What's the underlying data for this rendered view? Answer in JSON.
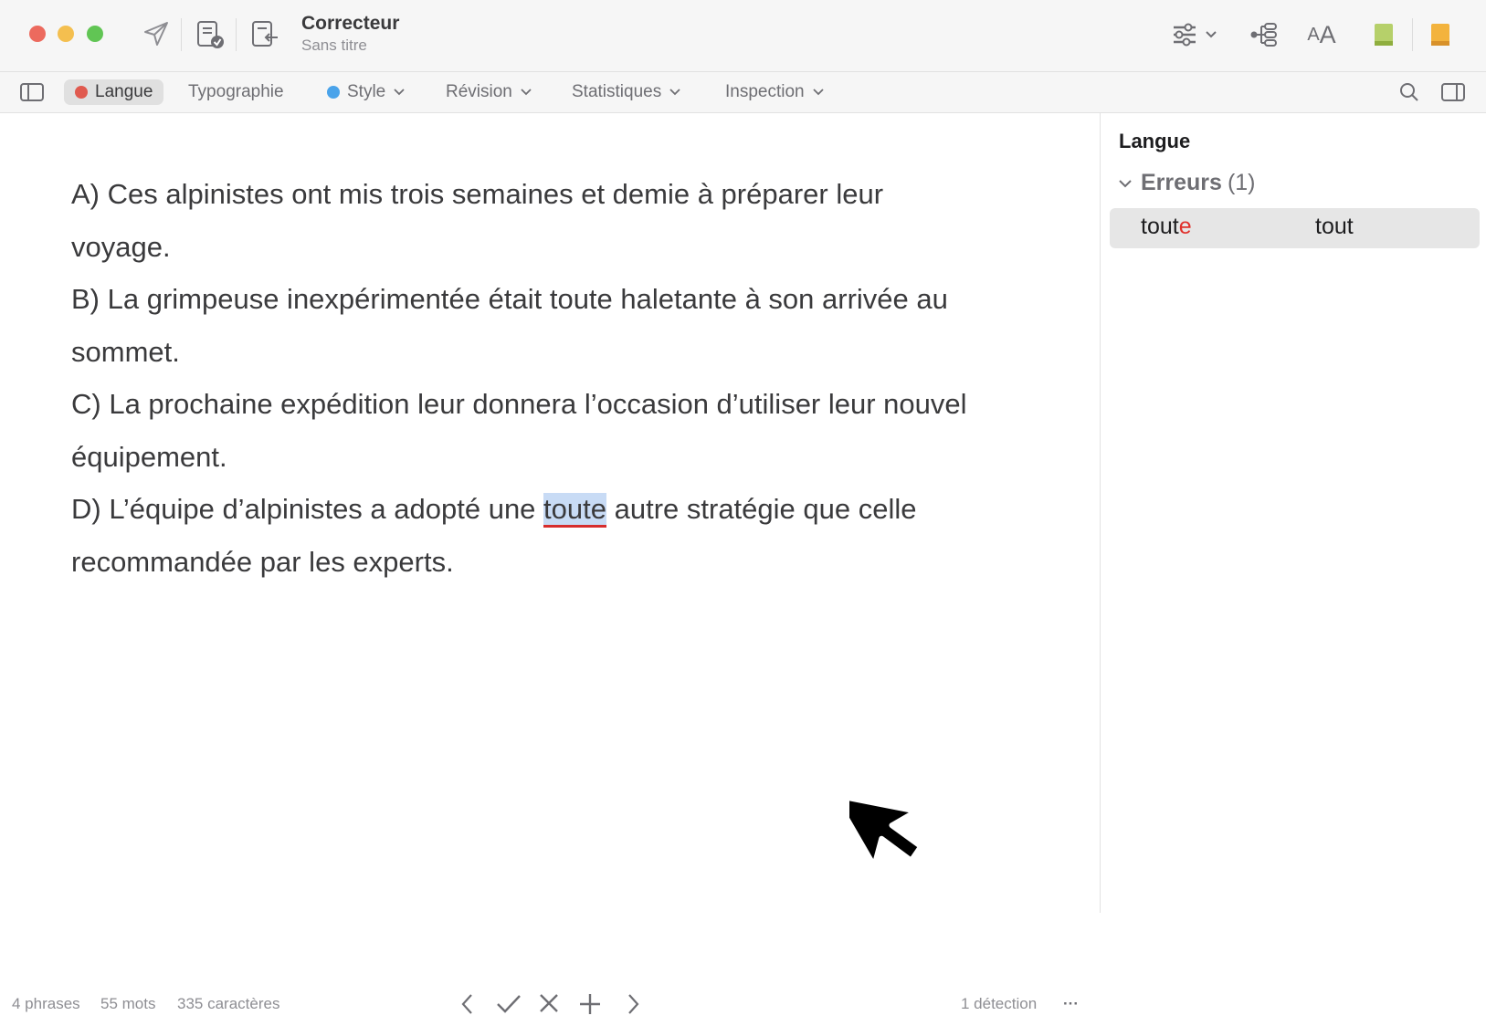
{
  "app": {
    "title": "Correcteur",
    "subtitle": "Sans titre"
  },
  "tabs": [
    {
      "label": "Langue",
      "dot_color": "#e05a4f",
      "active": true
    },
    {
      "label": "Typographie"
    },
    {
      "label": "Style",
      "dot_color": "#4aa3ea"
    },
    {
      "label": "Révision"
    },
    {
      "label": "Statistiques"
    },
    {
      "label": "Inspection"
    }
  ],
  "document": {
    "lines": [
      "A) Ces alpinistes ont mis trois semaines et demie à préparer leur",
      "voyage.",
      "B) La grimpeuse inexpérimentée était toute haletante à son arrivée au",
      "sommet.",
      "C) La prochaine expédition leur donnera l’occasion d’utiliser leur nouvel",
      "équipement.",
      "recommandée par les experts."
    ],
    "line_d_before": "D) L’équipe d’alpinistes a adopté une ",
    "line_d_error": "toute",
    "line_d_after": " autre stratégie que celle"
  },
  "status": {
    "phrases": "4 phrases",
    "words": "55 mots",
    "chars": "335 caractères",
    "detections": "1 détection",
    "more": "···"
  },
  "sidebar": {
    "title": "Langue",
    "errors_label": "Erreurs",
    "errors_count": "(1)",
    "error_word_start": "tout",
    "error_word_wrong": "e",
    "suggestion": "tout"
  },
  "icons": {
    "send": "paper-plane-icon",
    "doc_check": "document-check-icon",
    "doc_import": "document-import-icon",
    "sliders": "sliders-icon",
    "tree": "tree-icon",
    "text_size": "AA",
    "book_green": "book-green-icon",
    "book_orange": "book-orange-icon"
  }
}
